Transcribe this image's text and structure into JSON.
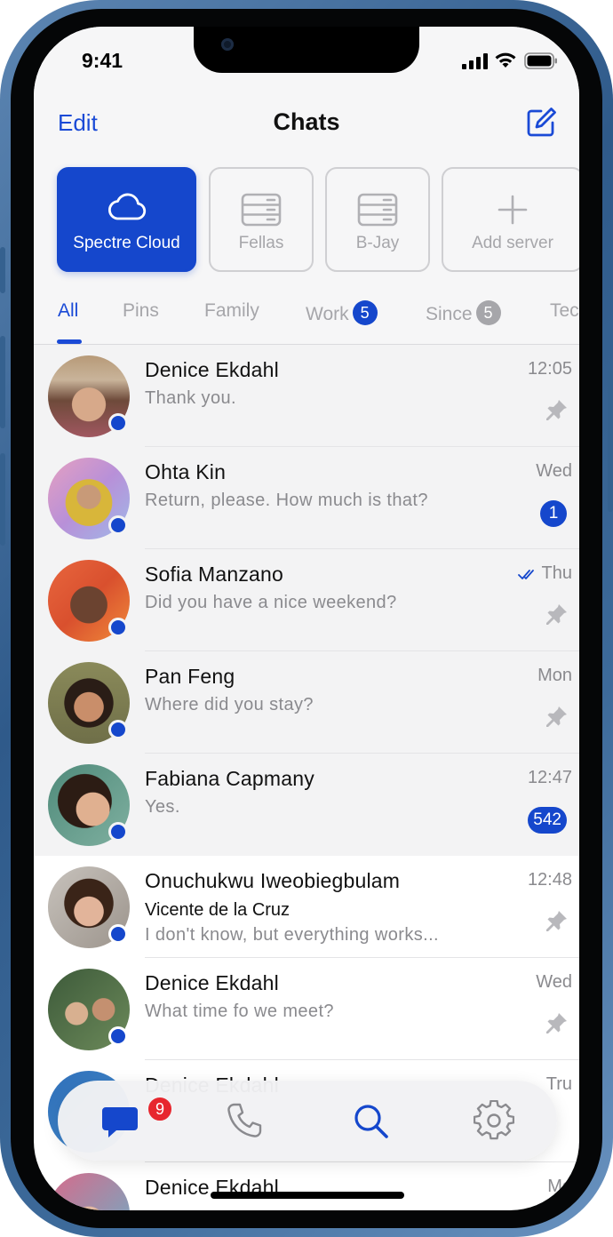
{
  "status_bar": {
    "time": "9:41"
  },
  "nav": {
    "edit_label": "Edit",
    "title": "Chats"
  },
  "servers": [
    {
      "label": "Spectre Cloud",
      "icon": "cloud-icon",
      "active": true
    },
    {
      "label": "Fellas",
      "icon": "server-icon",
      "active": false
    },
    {
      "label": "B-Jay",
      "icon": "server-icon",
      "active": false
    },
    {
      "label": "Add server",
      "icon": "plus-icon",
      "active": false
    }
  ],
  "tabs": [
    {
      "label": "All",
      "active": true
    },
    {
      "label": "Pins"
    },
    {
      "label": "Family"
    },
    {
      "label": "Work",
      "badge": "5",
      "badge_color": "#1547cc"
    },
    {
      "label": "Since",
      "badge": "5",
      "badge_color": "#a6a6aa"
    },
    {
      "label": "Tec"
    }
  ],
  "chats": [
    {
      "name": "Denice Ekdahl",
      "message": "Thank you.",
      "time": "12:05",
      "pinned": true
    },
    {
      "name": "Ohta Kin",
      "message": "Return, please. How much is that?",
      "time": "Wed",
      "unread": "1",
      "pinned": true
    },
    {
      "name": "Sofia Manzano",
      "message": "Did you have a nice weekend?",
      "time": "Thu",
      "read_receipt": true,
      "pinned": true
    },
    {
      "name": "Pan Feng",
      "message": "Where did you stay?",
      "time": "Mon",
      "pinned": true
    },
    {
      "name": "Fabiana Capmany",
      "message": "Yes.",
      "time": "12:47",
      "unread": "542",
      "pinned": true
    },
    {
      "name": "Onuchukwu Iweobiegbulam",
      "sender": "Vicente de la Cruz",
      "message": "I don't know, but everything works...",
      "time": "12:48",
      "pinned": false
    },
    {
      "name": "Denice Ekdahl",
      "message": "What time fo we meet?",
      "time": "Wed",
      "pinned": false
    },
    {
      "name": "Denice Ekdahl",
      "message": "",
      "time": "Tru",
      "pinned": false
    },
    {
      "name": "Denice Ekdahl",
      "message": "",
      "time": "Mo",
      "pinned": false
    }
  ],
  "tabbar": {
    "chats_badge": "9",
    "items": [
      "chats-icon",
      "phone-icon",
      "search-icon",
      "settings-icon"
    ]
  },
  "colors": {
    "accent": "#1547cc",
    "badge_red": "#e7262e",
    "muted": "#8a8a8e"
  }
}
